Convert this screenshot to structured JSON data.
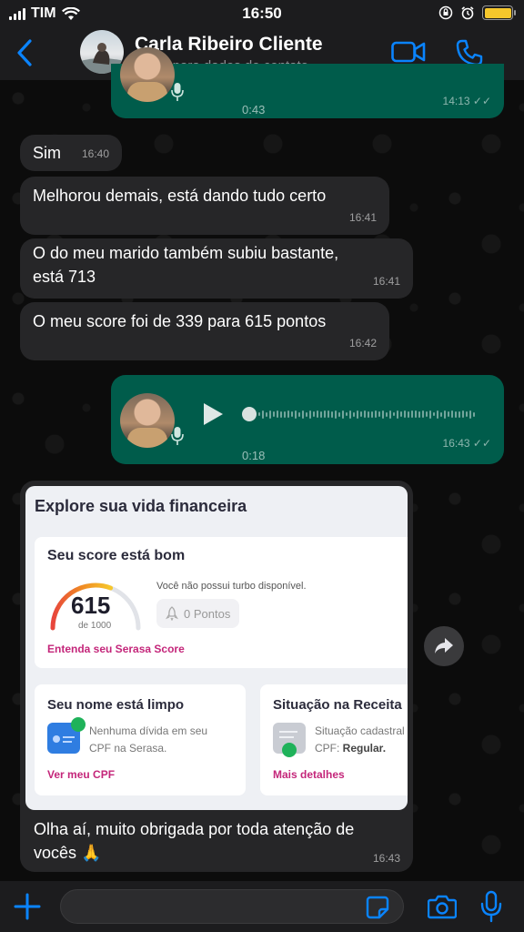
{
  "status_bar": {
    "carrier": "TIM",
    "time": "16:50",
    "battery_color": "#f6c72c"
  },
  "header": {
    "contact_name": "Carla Ribeiro Cliente",
    "subtitle": "toque para dados do contato",
    "accent": "#0a84ff",
    "icons": [
      "back-chevron-icon",
      "video-call-icon",
      "phone-icon"
    ]
  },
  "messages": [
    {
      "dir": "out",
      "type": "voice",
      "duration": "0:43",
      "time": "14:13"
    },
    {
      "dir": "in",
      "type": "text",
      "text": "Sim",
      "time": "16:40"
    },
    {
      "dir": "in",
      "type": "text",
      "text": "Melhorou demais, está dando tudo certo",
      "time": "16:41"
    },
    {
      "dir": "in",
      "type": "text",
      "text": "O do meu marido também subiu bastante, está 713",
      "time": "16:41"
    },
    {
      "dir": "in",
      "type": "text",
      "text": "O meu score foi de 339 para 615 pontos",
      "time": "16:42"
    },
    {
      "dir": "out",
      "type": "voice",
      "duration": "0:18",
      "time": "16:43"
    },
    {
      "dir": "in",
      "type": "image",
      "caption": "Olha aí, muito obrigada por toda atenção de vocês 🙏",
      "time": "16:43"
    }
  ],
  "image_card": {
    "title": "Explore sua vida financeira",
    "score": {
      "heading": "Seu score está bom",
      "value": "615",
      "max": "de 1000",
      "turbo_text": "Você não possui turbo disponível.",
      "pontos": "0 Pontos",
      "link": "Entenda seu Serasa Score",
      "gauge_fraction": 0.615
    },
    "nome": {
      "heading": "Seu nome está limpo",
      "line1": "Nenhuma dívida em seu",
      "line2": "CPF na Serasa.",
      "link": "Ver meu CPF"
    },
    "receita": {
      "heading": "Situação na Receita",
      "line1": "Situação cadastral",
      "line2_label": "CPF: ",
      "line2_value": "Regular.",
      "link": "Mais detalhes"
    }
  },
  "colors": {
    "incoming_bubble": "#262628",
    "outgoing_bubble": "#005c4b",
    "serasa_pink": "#c4267a"
  },
  "input_bar": {
    "placeholder": ""
  }
}
